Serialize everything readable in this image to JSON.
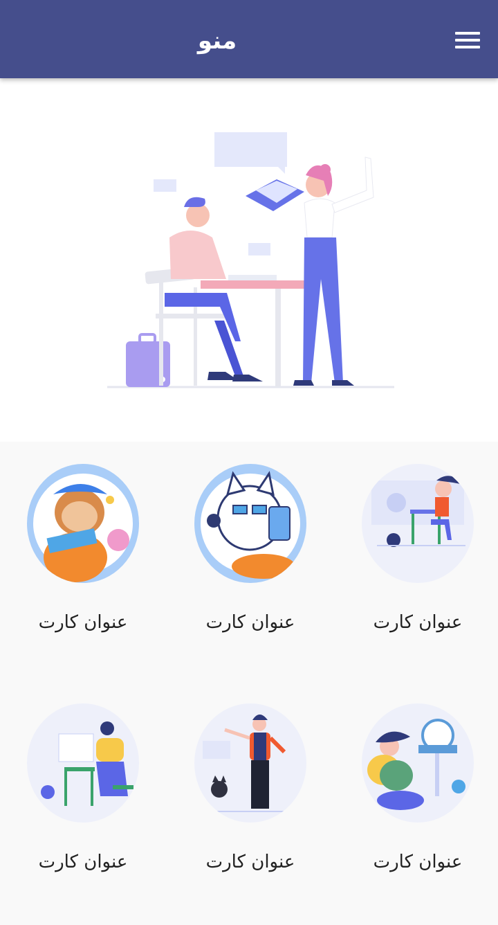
{
  "appbar": {
    "title": "منو",
    "menu_icon": "hamburger-menu-icon",
    "color": "#454e8c"
  },
  "hero": {
    "illustration": "teacher-and-student-illustration"
  },
  "cards": [
    {
      "title": "عنوان کارت",
      "image": "sloth-with-pipe"
    },
    {
      "title": "عنوان کارت",
      "image": "cat-with-headset"
    },
    {
      "title": "عنوان کارت",
      "image": "woman-at-desk"
    },
    {
      "title": "عنوان کارت",
      "image": "painter-at-easel"
    },
    {
      "title": "عنوان کارت",
      "image": "man-with-cat"
    },
    {
      "title": "عنوان کارت",
      "image": "traveler-resting"
    }
  ]
}
